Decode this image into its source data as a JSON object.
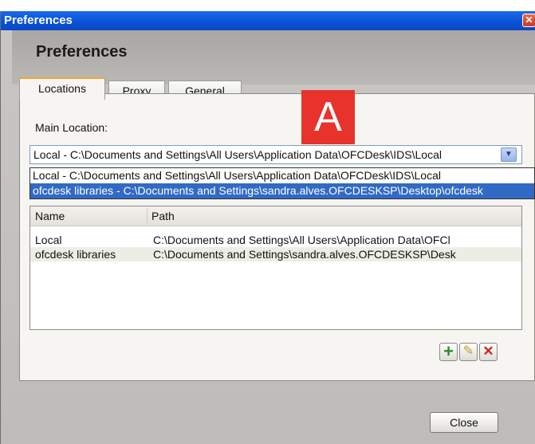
{
  "window": {
    "title": "Preferences",
    "heading": "Preferences"
  },
  "tabs": [
    {
      "label": "Locations",
      "active": true
    },
    {
      "label": "Proxy",
      "active": false
    },
    {
      "label": "General",
      "active": false
    }
  ],
  "main_location": {
    "label": "Main Location:",
    "selected_value": "Local - C:\\Documents and Settings\\All Users\\Application Data\\OFCDesk\\IDS\\Local",
    "options": [
      "Local - C:\\Documents and Settings\\All Users\\Application Data\\OFCDesk\\IDS\\Local",
      "ofcdesk libraries - C:\\Documents and Settings\\sandra.alves.OFCDESKSP\\Desktop\\ofcdesk"
    ]
  },
  "locations_table": {
    "columns": [
      "Name",
      "Path"
    ],
    "rows": [
      {
        "name": "Local",
        "path": "C:\\Documents and Settings\\All Users\\Application Data\\OFCl"
      },
      {
        "name": "ofcdesk libraries",
        "path": "C:\\Documents and Settings\\sandra.alves.OFCDESKSP\\Desk"
      }
    ]
  },
  "toolbar": {
    "add_icon": "plus-icon",
    "edit_icon": "pencil-icon",
    "delete_icon": "delete-x-icon"
  },
  "footer": {
    "close_label": "Close"
  },
  "annotation": {
    "letter": "A",
    "color": "#e8332c"
  },
  "colors": {
    "title_bar": "#0a52d6",
    "selection": "#316ac5",
    "active_tab_accent": "#f2a531"
  }
}
